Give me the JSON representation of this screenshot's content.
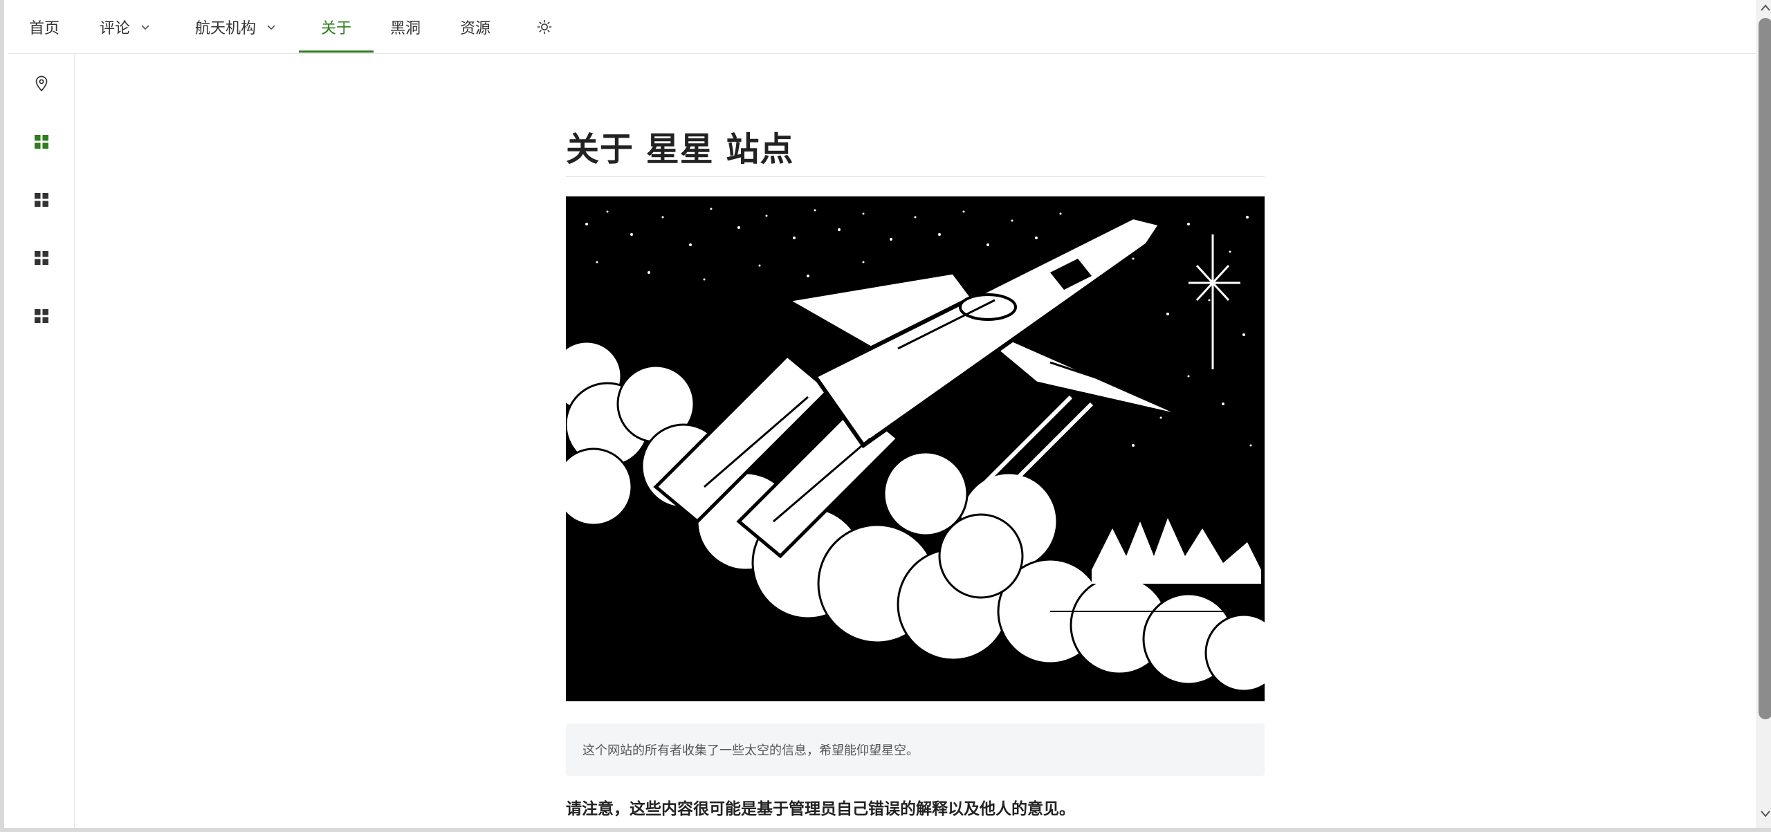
{
  "nav": {
    "items": [
      {
        "label": "首页",
        "has_dropdown": false,
        "active": false
      },
      {
        "label": "评论",
        "has_dropdown": true,
        "active": false
      },
      {
        "label": "航天机构",
        "has_dropdown": true,
        "active": false
      },
      {
        "label": "关于",
        "has_dropdown": false,
        "active": true
      },
      {
        "label": "黑洞",
        "has_dropdown": false,
        "active": false
      },
      {
        "label": "资源",
        "has_dropdown": false,
        "active": false
      }
    ],
    "theme_icon": "sun-icon",
    "accent_color": "#2e7d1f"
  },
  "sidebar": {
    "icons": [
      {
        "name": "location-pin-icon",
        "active": false
      },
      {
        "name": "grid-icon",
        "active": true
      },
      {
        "name": "grid-icon",
        "active": false
      },
      {
        "name": "grid-icon",
        "active": false
      },
      {
        "name": "grid-icon",
        "active": false
      }
    ]
  },
  "main": {
    "title": "关于 星星 站点",
    "hero_image": "rocket-launch-illustration",
    "quote": "这个网站的所有者收集了一些太空的信息，希望能仰望星空。",
    "notice": "请注意，这些内容很可能是基于管理员自己错误的解释以及他人的意见。"
  }
}
